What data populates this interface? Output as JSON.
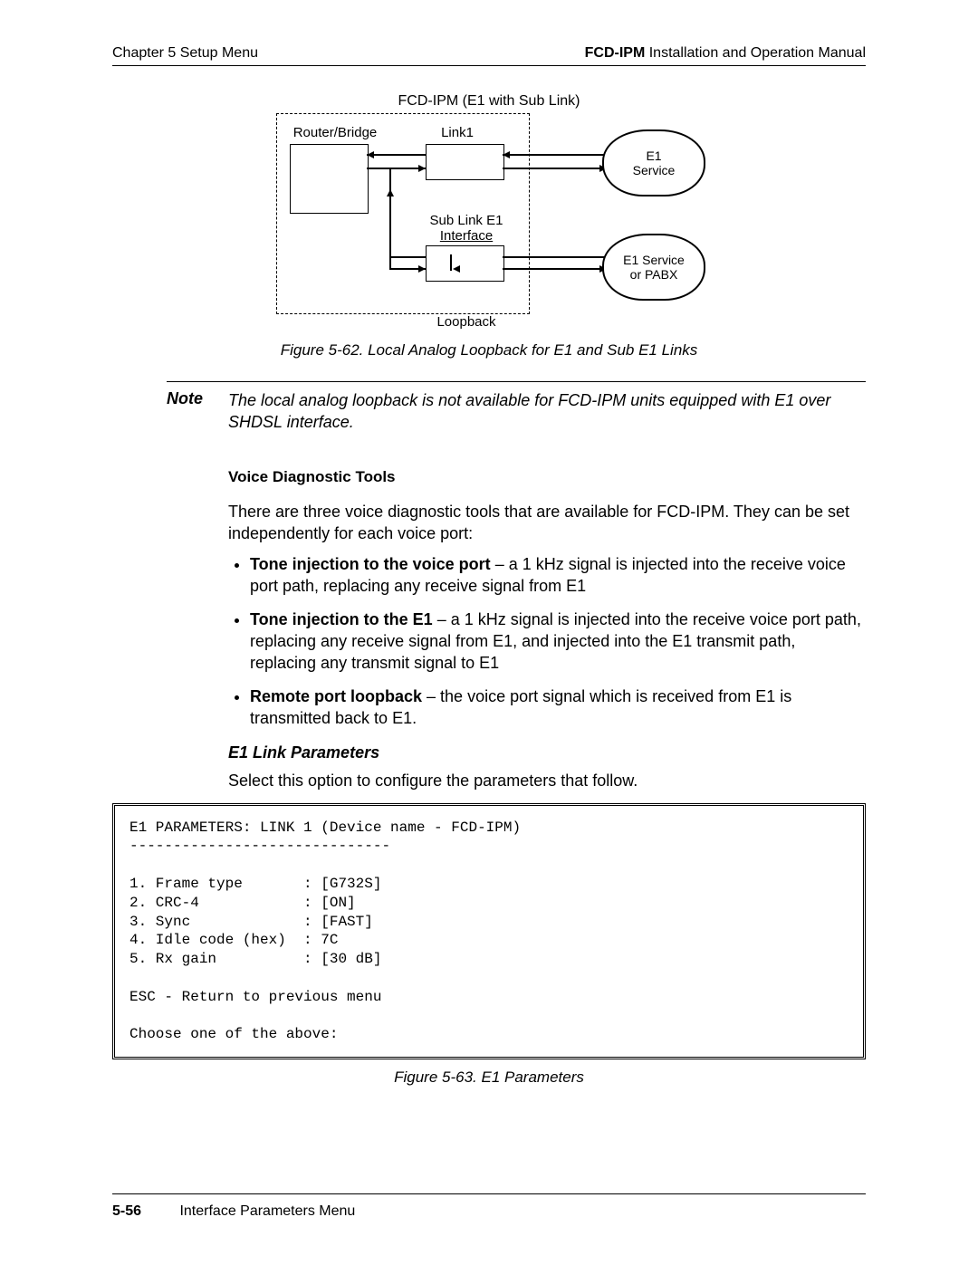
{
  "header": {
    "left_chapter": "Chapter 5  Setup Menu",
    "right_product": "FCD-IPM",
    "right_rest": " Installation and Operation Manual"
  },
  "diagram": {
    "title": "FCD-IPM (E1 with Sub Link)",
    "router_bridge": "Router/Bridge",
    "link1": "Link1",
    "sub_link": "Sub Link E1",
    "interface": "Interface",
    "e1_service": "E1",
    "service": "Service",
    "e1_service2a": "E1 Service",
    "e1_service2b": "or PABX",
    "loopback": "Loopback"
  },
  "figure62_caption": "Figure 5-62.  Local Analog Loopback for E1 and Sub E1 Links",
  "note": {
    "label": "Note",
    "text": "The local analog loopback is not available for FCD-IPM units equipped with E1 over SHDSL interface."
  },
  "voice_tools": {
    "heading": "Voice Diagnostic Tools",
    "intro": "There are three voice diagnostic tools that are available for FCD-IPM. They can be set independently for each voice port:",
    "b1_bold": "Tone injection to the voice port",
    "b1_rest": " – a 1 kHz signal is injected into the receive voice port path, replacing any receive signal from E1",
    "b2_bold": "Tone injection to the E1",
    "b2_rest": " – a 1 kHz signal is injected into the receive voice port path, replacing any receive signal from E1, and injected into the E1 transmit path, replacing any transmit signal to E1",
    "b3_bold": "Remote port loopback",
    "b3_rest": " – the voice port signal which is received from E1 is transmitted back to E1."
  },
  "e1_link": {
    "heading": "E1 Link Parameters",
    "intro": "Select this option to configure the parameters that follow."
  },
  "code": {
    "l1": "E1 PARAMETERS: LINK 1 (Device name - FCD-IPM)",
    "l2": "------------------------------",
    "l3": "",
    "l4": "1. Frame type       : [G732S]",
    "l5": "2. CRC-4            : [ON]",
    "l6": "3. Sync             : [FAST]",
    "l7": "4. Idle code (hex)  : 7C",
    "l8": "5. Rx gain          : [30 dB]",
    "l9": "",
    "l10": "ESC - Return to previous menu",
    "l11": "",
    "l12": "Choose one of the above:"
  },
  "figure63_caption": "Figure 5-63.  E1 Parameters",
  "footer": {
    "pagenum": "5-56",
    "section": "Interface Parameters Menu"
  }
}
